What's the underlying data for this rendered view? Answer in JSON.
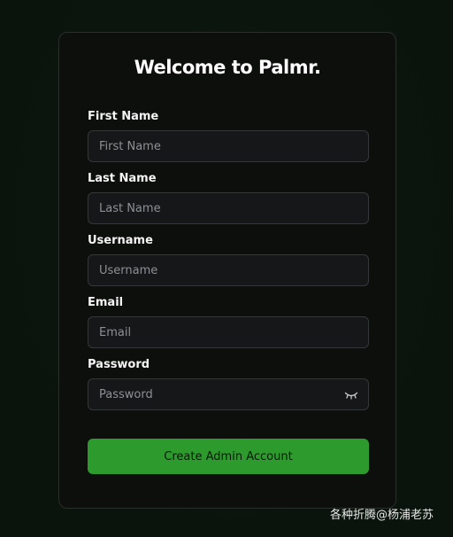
{
  "form": {
    "title": "Welcome to Palmr.",
    "fields": [
      {
        "label": "First Name",
        "placeholder": "First Name",
        "value": ""
      },
      {
        "label": "Last Name",
        "placeholder": "Last Name",
        "value": ""
      },
      {
        "label": "Username",
        "placeholder": "Username",
        "value": ""
      },
      {
        "label": "Email",
        "placeholder": "Email",
        "value": ""
      },
      {
        "label": "Password",
        "placeholder": "Password",
        "value": ""
      }
    ],
    "password_toggle_icon": "eye-closed-icon",
    "submit_label": "Create Admin Account"
  },
  "watermark": "各种折腾@杨浦老苏",
  "colors": {
    "background": "#0b150d",
    "card": "#0d0f0d",
    "input": "#161718",
    "accent": "#2d9a2d"
  }
}
